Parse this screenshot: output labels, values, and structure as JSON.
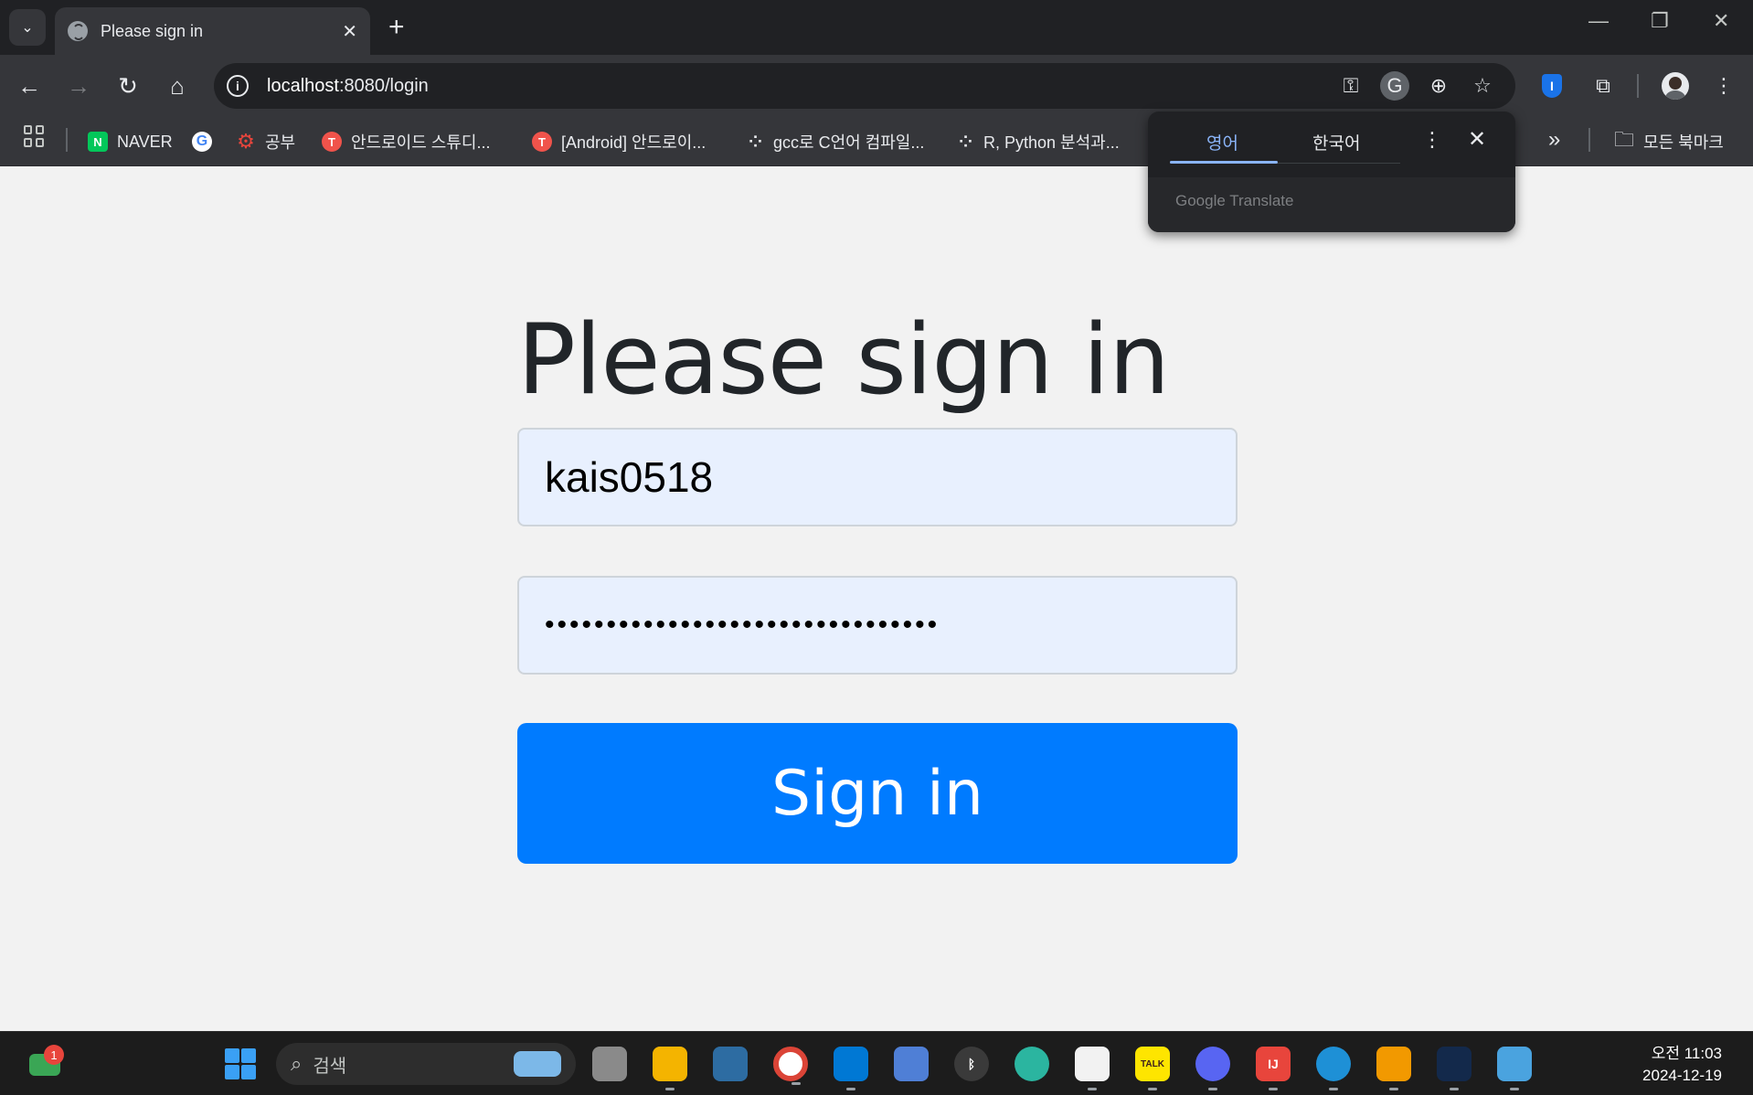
{
  "browser": {
    "tab_title": "Please sign in",
    "url_host": "localhost",
    "url_rest": ":8080/login"
  },
  "bookmarks": [
    {
      "label": "NAVER",
      "fav": "N",
      "kind": "naver"
    },
    {
      "label": "",
      "fav": "G",
      "kind": "google"
    },
    {
      "label": "공부",
      "fav": "⚙",
      "kind": "gear-red"
    },
    {
      "label": "안드로이드 스튜디...",
      "fav": "T",
      "kind": "round-red"
    },
    {
      "label": "[Android] 안드로이...",
      "fav": "T",
      "kind": "round-red"
    },
    {
      "label": "gcc로 C언어 컴파일...",
      "fav": "⁘",
      "kind": "dots"
    },
    {
      "label": "R, Python 분석과...",
      "fav": "⁘",
      "kind": "dots"
    }
  ],
  "bookmarks_more": "»",
  "all_bookmarks_label": "모든 북마크",
  "translate_popup": {
    "source_lang": "영어",
    "target_lang": "한국어",
    "brand": "Google Translate"
  },
  "login": {
    "heading": "Please sign in",
    "username_value": "kais0518",
    "password_value": "••••••••••••••••••••••••••••••••",
    "submit_label": "Sign in"
  },
  "taskbar": {
    "notification_count": "1",
    "search_placeholder": "검색",
    "clock_time": "오전 11:03",
    "clock_date": "2024-12-19"
  },
  "icons": {
    "colors": {
      "accent": "#007bff",
      "input_bg": "#e8f0fe",
      "chrome_dark": "#202124",
      "toolbar": "#35363a"
    }
  }
}
